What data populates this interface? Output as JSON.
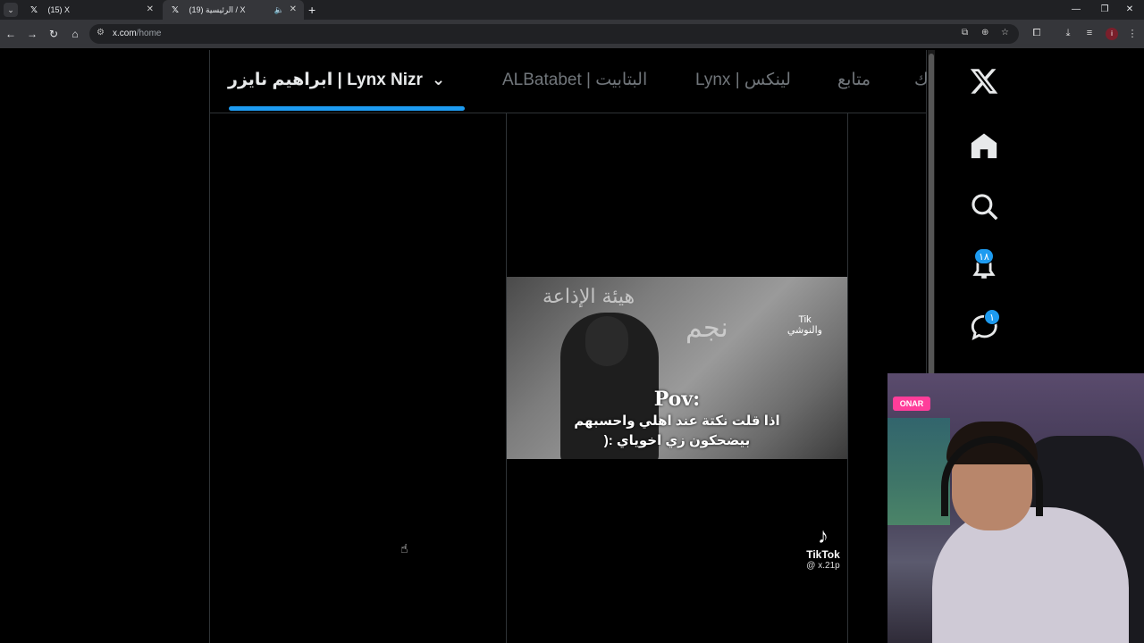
{
  "browser": {
    "tabs": [
      {
        "title": "(15) X",
        "favicon": "x-logo-icon"
      },
      {
        "title": "(19) الرئيسية / X",
        "favicon": "x-logo-icon",
        "active": true
      }
    ],
    "url_host": "x.com",
    "url_path": "/home",
    "profile_initial": "i"
  },
  "feed_tabs": [
    {
      "label": "ابراهيم نايزر | Lynx Nizr",
      "active": true
    },
    {
      "label": "ALBatabet | البتابيت"
    },
    {
      "label": "Lynx | لينكس"
    },
    {
      "label": "متابع"
    },
    {
      "label": "ك"
    }
  ],
  "sidebar": {
    "notifications_badge": "١٨",
    "messages_badge": "١"
  },
  "video": {
    "title": "Pov:",
    "line1": "اذا قلت نكتة عند اهلي واحسبهم",
    "line2": "بيضحكون زي اخوياي :(",
    "tag_top": "Tik",
    "tag_bottom": "والنوشي",
    "bg_text_1": "هيئة الإذاعة",
    "bg_text_2": "نجم"
  },
  "tiktok": {
    "brand": "TikTok",
    "handle": "@ x.21p"
  },
  "webcam": {
    "sign": "ONAR"
  },
  "colors": {
    "accent": "#1d9bf0",
    "background": "#000000",
    "border": "#2f3336"
  }
}
